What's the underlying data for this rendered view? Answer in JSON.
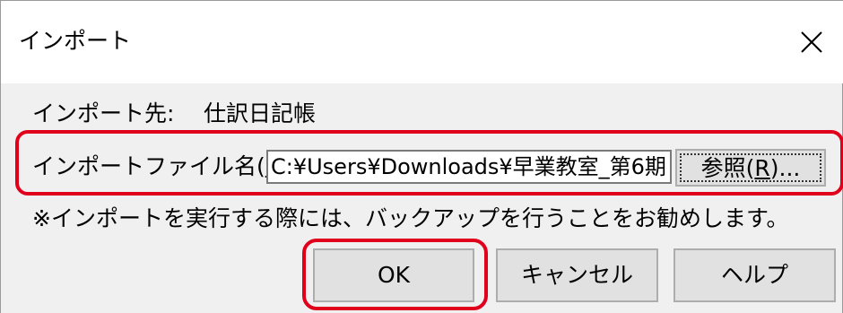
{
  "dialog": {
    "title": "インポート",
    "close_icon": "close-icon"
  },
  "destination": {
    "label": "インポート先:",
    "value": "仕訳日記帳"
  },
  "file": {
    "label": "インポートファイル名(I):",
    "path_value": "C:¥Users¥Downloads¥早業教室_第6期",
    "browse_label": "参照(R)..."
  },
  "notice": "※インポートを実行する際には、バックアップを行うことをお勧めします。",
  "buttons": {
    "ok": "OK",
    "cancel": "キャンセル",
    "help": "ヘルプ"
  },
  "highlight_color": "#e0001b"
}
